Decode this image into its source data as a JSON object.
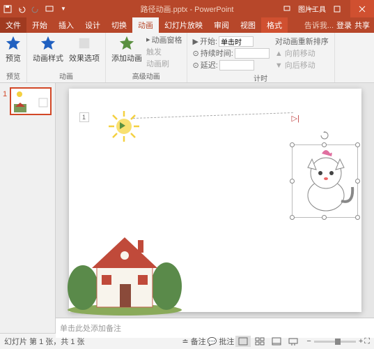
{
  "title": "路径动画.pptx - PowerPoint",
  "tool_tab": "图片工具",
  "menu": {
    "file": "文件",
    "home": "开始",
    "insert": "插入",
    "design": "设计",
    "transitions": "切换",
    "animations": "动画",
    "slideshow": "幻灯片放映",
    "review": "审阅",
    "view": "视图",
    "format": "格式"
  },
  "right": {
    "tell_me": "告诉我...",
    "login": "登录",
    "share": "共享"
  },
  "ribbon": {
    "preview": "预览",
    "preview_grp": "预览",
    "anim_style": "动画样式",
    "effect_options": "效果选项",
    "anim_grp": "动画",
    "add_anim": "添加动画",
    "anim_pane": "动画窗格",
    "trigger": "触发",
    "anim_painter": "动画刷",
    "adv_grp": "高级动画",
    "start_label": "开始:",
    "start_value": "单击时",
    "duration_label": "持续时间:",
    "delay_label": "延迟:",
    "timing_grp": "计时",
    "reorder_title": "对动画重新排序",
    "move_earlier": "向前移动",
    "move_later": "向后移动"
  },
  "thumb_num": "1",
  "anim_tag": "1",
  "notes_placeholder": "单击此处添加备注",
  "status": {
    "slide_info": "幻灯片 第 1 张，共 1 张",
    "notes": "备注",
    "comments": "批注"
  },
  "win": {
    "share": "共享"
  }
}
